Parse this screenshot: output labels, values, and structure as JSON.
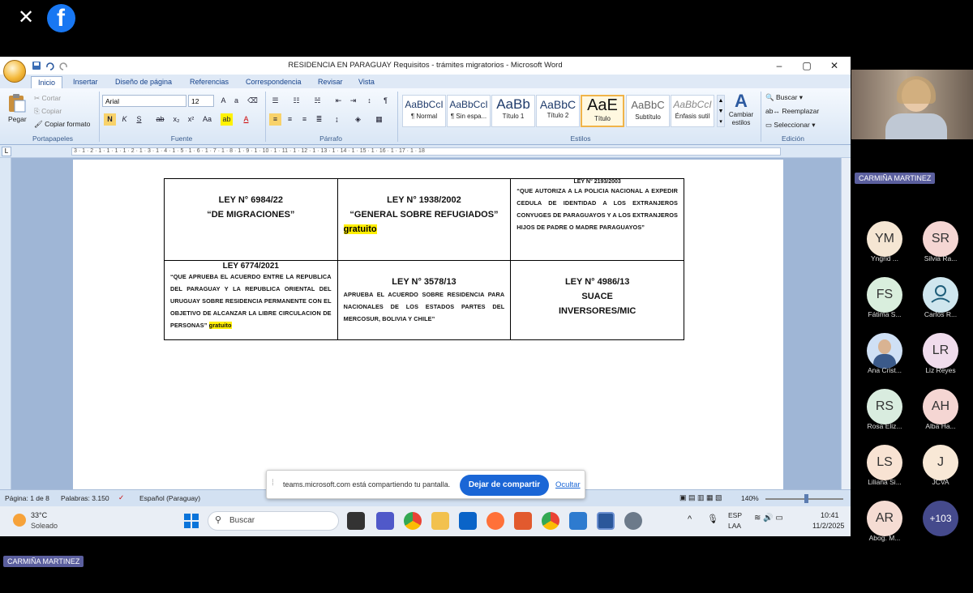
{
  "app": {
    "close_glyph": "✕",
    "facebook_glyph": "f"
  },
  "word": {
    "title": "RESIDENCIA EN PARAGUAY Requisitos - trámites migratorios - Microsoft Word",
    "window_controls": [
      "–",
      "▢",
      "✕"
    ],
    "tabs": [
      "Inicio",
      "Insertar",
      "Diseño de página",
      "Referencias",
      "Correspondencia",
      "Revisar",
      "Vista"
    ],
    "clipboard": {
      "paste": "Pegar",
      "cut": "Cortar",
      "copy": "Copiar",
      "format_painter": "Copiar formato",
      "group": "Portapapeles"
    },
    "font": {
      "name": "Arial",
      "size": "12",
      "group": "Fuente"
    },
    "paragraph": {
      "group": "Párrafo"
    },
    "styles": {
      "group": "Estilos",
      "change_label": "Cambiar estilos",
      "items": [
        {
          "sample": "AaBbCcI",
          "label": "¶ Normal"
        },
        {
          "sample": "AaBbCcI",
          "label": "¶ Sin espa..."
        },
        {
          "sample": "AaBb",
          "label": "Título 1"
        },
        {
          "sample": "AaBbC",
          "label": "Título 2"
        },
        {
          "sample": "AaE",
          "label": "Título"
        },
        {
          "sample": "AaBbC",
          "label": "Subtítulo"
        },
        {
          "sample": "AaBbCcI",
          "label": "Énfasis sutil"
        }
      ]
    },
    "editing": {
      "find": "Buscar",
      "replace": "Reemplazar",
      "select": "Seleccionar",
      "group": "Edición"
    },
    "ruler_numbers": "3 · 1 · 2 · 1 · 1 · 1 · 1 · 2 · 1 · 3 · 1 · 4 · 1 · 5 · 1 · 6 · 1 · 7 · 1 · 8 · 1 · 9 · 1 · 10 · 1 · 11 · 1 · 12 · 1 · 13 · 1 · 14 · 1 · 15 · 1 · 16 · 1 · 17 · 1 · 18",
    "statusbar": {
      "page": "Página: 1 de 8",
      "words": "Palabras: 3.150",
      "language": "Español (Paraguay)",
      "zoom": "140%"
    }
  },
  "table": {
    "c1": {
      "title": "LEY N° 6984/22",
      "subtitle": "“DE MIGRACIONES”"
    },
    "c2": {
      "title": "LEY N° 1938/2002",
      "subtitle": "“GENERAL SOBRE REFUGIADOS”",
      "tag": "gratuito"
    },
    "c3": {
      "title": "LEY N° 2193/2003",
      "text": "“QUE AUTORIZA A LA POLICIA NACIONAL A EXPEDIR CEDULA DE IDENTIDAD A LOS EXTRANJEROS CONYUGES DE PARAGUAYOS Y A LOS EXTRANJEROS HIJOS DE PADRE O MADRE PARAGUAYOS”"
    },
    "c4": {
      "title": "LEY 6774/2021",
      "text": "“QUE APRUEBA EL ACUERDO ENTRE LA REPUBLICA DEL PARAGUAY Y LA REPUBLICA ORIENTAL DEL URUGUAY SOBRE RESIDENCIA PERMANENTE CON EL OBJETIVO DE ALCANZAR LA LIBRE CIRCULACION DE PERSONAS”",
      "tag": "gratuito"
    },
    "c5": {
      "title": "LEY N° 3578/13",
      "text": "APRUEBA EL ACUERDO SOBRE RESIDENCIA PARA NACIONALES DE LOS ESTADOS PARTES DEL MERCOSUR, BOLIVIA Y CHILE”"
    },
    "c6": {
      "title": "LEY N° 4986/13",
      "line2": "SUACE",
      "line3": "INVERSORES/MIC"
    }
  },
  "sharing": {
    "message": "teams.microsoft.com está compartiendo tu pantalla.",
    "stop_button": "Dejar de compartir",
    "hide_link": "Ocultar"
  },
  "taskbar": {
    "weather_temp": "33°C",
    "weather_desc": "Soleado",
    "search_placeholder": "Buscar",
    "lang_top": "ESP",
    "lang_bottom": "LAA",
    "time": "10:41",
    "date": "11/2/2025"
  },
  "meeting": {
    "presenter_name": "CARMIÑA MARTINEZ",
    "selfview_name": "CARMIÑA MARTINEZ",
    "participants": [
      {
        "initials": "YM",
        "name": "Yngrid ...",
        "color": "#f5e6d3"
      },
      {
        "initials": "SR",
        "name": "Silvia Ra...",
        "color": "#f5d6d3"
      },
      {
        "initials": "FS",
        "name": "Fátima S...",
        "color": "#d9eedd"
      },
      {
        "initials": "",
        "name": "Carlos R...",
        "color": "#cfe6ee"
      },
      {
        "initials": "",
        "name": "Ana Crist...",
        "color": "#cfe0f5"
      },
      {
        "initials": "LR",
        "name": "Liz Reyes",
        "color": "#f0dcec"
      },
      {
        "initials": "RS",
        "name": "Rosa Eliz...",
        "color": "#d9ecdf"
      },
      {
        "initials": "AH",
        "name": "Alba Ha...",
        "color": "#f5d6d3"
      },
      {
        "initials": "LS",
        "name": "Liliana Si...",
        "color": "#f8e3d3"
      },
      {
        "initials": "J",
        "name": "JCVA",
        "color": "#f8e8d6"
      },
      {
        "initials": "AR",
        "name": "Abog. M...",
        "color": "#f5dcd3"
      },
      {
        "initials": "+103",
        "name": "",
        "color": "#454a8c"
      }
    ]
  }
}
